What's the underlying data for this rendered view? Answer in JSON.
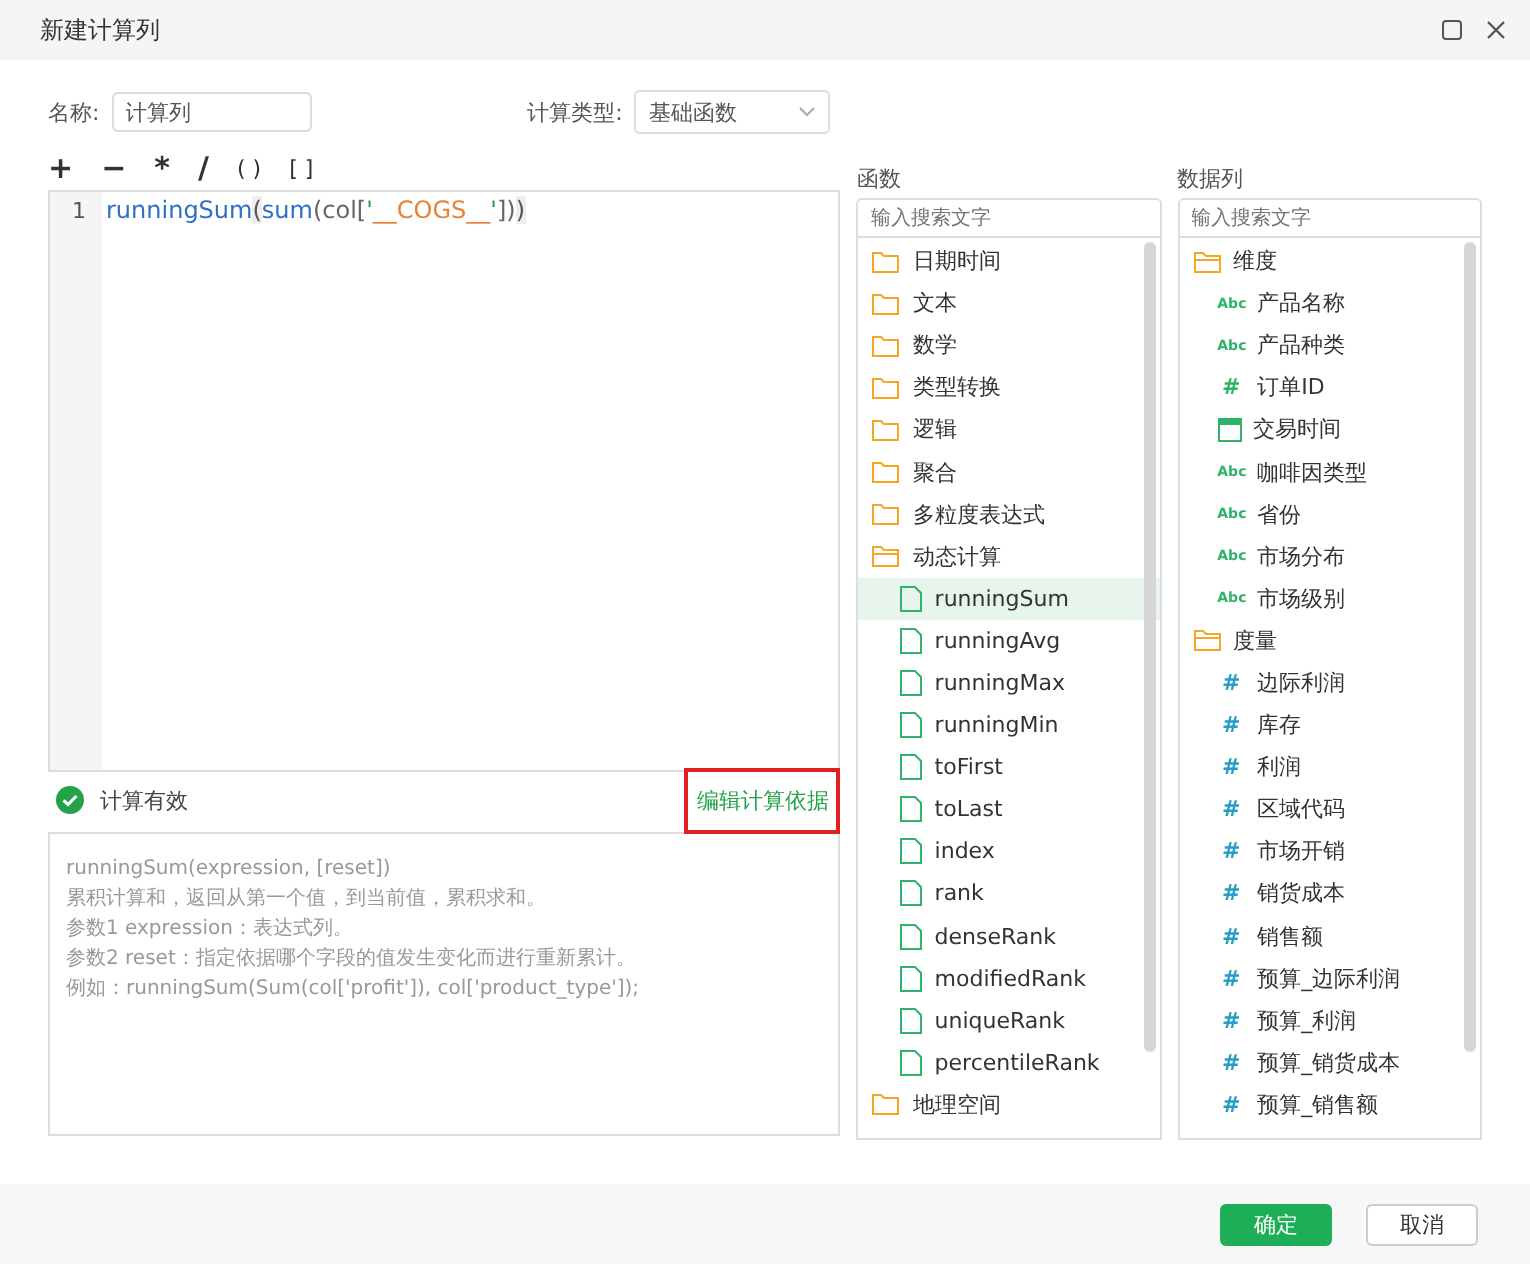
{
  "window": {
    "title": "新建计算列"
  },
  "form": {
    "name_label": "名称:",
    "name_value": "计算列",
    "type_label": "计算类型:",
    "type_value": "基础函数"
  },
  "toolbar": [
    "+",
    "−",
    "*",
    "/",
    "( )",
    "[ ]"
  ],
  "editor": {
    "line_number": "1",
    "tokens": [
      {
        "text": "runningSum",
        "kind": "func"
      },
      {
        "text": "(",
        "kind": "paren"
      },
      {
        "text": "sum",
        "kind": "func"
      },
      {
        "text": "(col[",
        "kind": "plain"
      },
      {
        "text": "'",
        "kind": "quote"
      },
      {
        "text": "__COGS__",
        "kind": "string"
      },
      {
        "text": "'",
        "kind": "quote"
      },
      {
        "text": "])",
        "kind": "plain"
      },
      {
        "text": ")",
        "kind": "paren"
      }
    ]
  },
  "status": {
    "valid": true,
    "text": "计算有效",
    "link": "编辑计算依据",
    "highlighted": true
  },
  "description": [
    "runningSum(expression, [reset])",
    "累积计算和，返回从第一个值，到当前值，累积求和。",
    "参数1 expression：表达式列。",
    "参数2 reset：指定依据哪个字段的值发生变化而进行重新累计。",
    "例如：runningSum(Sum(col['profit']), col['product_type']);"
  ],
  "functions": {
    "label": "函数",
    "placeholder": "输入搜索文字",
    "items": [
      {
        "label": "日期时间",
        "expanded": false
      },
      {
        "label": "文本",
        "expanded": false
      },
      {
        "label": "数学",
        "expanded": false
      },
      {
        "label": "类型转换",
        "expanded": false
      },
      {
        "label": "逻辑",
        "expanded": false
      },
      {
        "label": "聚合",
        "expanded": false
      },
      {
        "label": "多粒度表达式",
        "expanded": false
      },
      {
        "label": "动态计算",
        "expanded": true,
        "children": [
          {
            "label": "runningSum",
            "selected": true
          },
          {
            "label": "runningAvg",
            "selected": false
          },
          {
            "label": "runningMax",
            "selected": false
          },
          {
            "label": "runningMin",
            "selected": false
          },
          {
            "label": "toFirst",
            "selected": false
          },
          {
            "label": "toLast",
            "selected": false
          },
          {
            "label": "index",
            "selected": false
          },
          {
            "label": "rank",
            "selected": false
          },
          {
            "label": "denseRank",
            "selected": false
          },
          {
            "label": "modifiedRank",
            "selected": false
          },
          {
            "label": "uniqueRank",
            "selected": false
          },
          {
            "label": "percentileRank",
            "selected": false
          }
        ]
      },
      {
        "label": "地理空间",
        "expanded": false
      }
    ]
  },
  "columns": {
    "label": "数据列",
    "placeholder": "输入搜索文字",
    "groups": [
      {
        "label": "维度",
        "kind": "dimension",
        "expanded": true,
        "children": [
          {
            "label": "产品名称",
            "kind": "text",
            "icon": "Abc"
          },
          {
            "label": "产品种类",
            "kind": "text",
            "icon": "Abc"
          },
          {
            "label": "订单ID",
            "kind": "number",
            "icon": "#"
          },
          {
            "label": "交易时间",
            "kind": "date"
          },
          {
            "label": "咖啡因类型",
            "kind": "text",
            "icon": "Abc"
          },
          {
            "label": "省份",
            "kind": "text",
            "icon": "Abc"
          },
          {
            "label": "市场分布",
            "kind": "text",
            "icon": "Abc"
          },
          {
            "label": "市场级别",
            "kind": "text",
            "icon": "Abc"
          }
        ]
      },
      {
        "label": "度量",
        "kind": "measure",
        "expanded": true,
        "children": [
          {
            "label": "边际利润",
            "kind": "number",
            "icon": "#"
          },
          {
            "label": "库存",
            "kind": "number",
            "icon": "#"
          },
          {
            "label": "利润",
            "kind": "number",
            "icon": "#"
          },
          {
            "label": "区域代码",
            "kind": "number",
            "icon": "#"
          },
          {
            "label": "市场开销",
            "kind": "number",
            "icon": "#"
          },
          {
            "label": "销货成本",
            "kind": "number",
            "icon": "#"
          },
          {
            "label": "销售额",
            "kind": "number",
            "icon": "#"
          },
          {
            "label": "预算_边际利润",
            "kind": "number",
            "icon": "#"
          },
          {
            "label": "预算_利润",
            "kind": "number",
            "icon": "#"
          },
          {
            "label": "预算_销货成本",
            "kind": "number",
            "icon": "#"
          },
          {
            "label": "预算_销售额",
            "kind": "number",
            "icon": "#"
          }
        ]
      }
    ]
  },
  "buttons": [
    {
      "label": "确定",
      "kind": "primary"
    },
    {
      "label": "取消",
      "kind": "secondary"
    }
  ]
}
